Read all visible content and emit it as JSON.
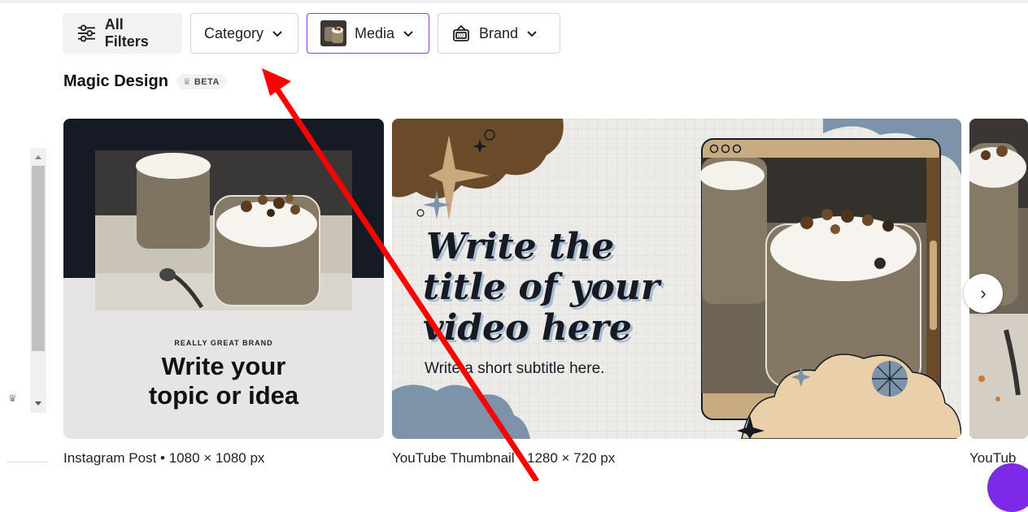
{
  "filters": {
    "all_filters": "All Filters",
    "category": "Category",
    "media": "Media",
    "brand": "Brand"
  },
  "section": {
    "title": "Magic Design",
    "badge": "BETA"
  },
  "cards": [
    {
      "brand_small": "REALLY GREAT BRAND",
      "heading_line1": "Write your",
      "heading_line2": "topic or idea",
      "caption": "Instagram Post • 1080 × 1080 px"
    },
    {
      "title_line1": "Write the",
      "title_line2": "title of your",
      "title_line3": "video here",
      "subtitle": "Write a short subtitle here.",
      "caption": "YouTube Thumbnail • 1280 × 720 px"
    },
    {
      "caption": "YouTub"
    }
  ],
  "colors": {
    "accent": "#8b3dff",
    "annotation_arrow": "#ff0000",
    "dark_panel": "#151a24",
    "cloud_brown": "#6b4a2a",
    "cloud_blue": "#7c93aa",
    "sand": "#e9d0a8"
  }
}
